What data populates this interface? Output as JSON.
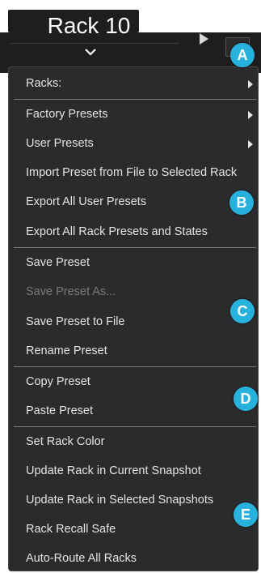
{
  "header": {
    "rack_title": "Rack 10"
  },
  "menu": {
    "items": [
      {
        "label": "Racks:",
        "submenu": true,
        "disabled": false
      },
      {
        "label": "Factory Presets",
        "submenu": true,
        "disabled": false
      },
      {
        "label": "User Presets",
        "submenu": true,
        "disabled": false
      },
      {
        "label": "Import Preset from File to Selected Rack",
        "submenu": false,
        "disabled": false
      },
      {
        "label": "Export All User Presets",
        "submenu": false,
        "disabled": false
      },
      {
        "label": "Export All Rack Presets and States",
        "submenu": false,
        "disabled": false
      },
      {
        "label": "Save Preset",
        "submenu": false,
        "disabled": false
      },
      {
        "label": "Save Preset As...",
        "submenu": false,
        "disabled": true
      },
      {
        "label": "Save Preset to File",
        "submenu": false,
        "disabled": false
      },
      {
        "label": "Rename Preset",
        "submenu": false,
        "disabled": false
      },
      {
        "label": "Copy Preset",
        "submenu": false,
        "disabled": false
      },
      {
        "label": "Paste Preset",
        "submenu": false,
        "disabled": false
      },
      {
        "label": "Set Rack Color",
        "submenu": false,
        "disabled": false
      },
      {
        "label": "Update Rack in Current Snapshot",
        "submenu": false,
        "disabled": false
      },
      {
        "label": "Update Rack in Selected Snapshots",
        "submenu": false,
        "disabled": false
      },
      {
        "label": "Rack Recall Safe",
        "submenu": false,
        "disabled": false
      },
      {
        "label": "Auto-Route All Racks",
        "submenu": false,
        "disabled": false
      }
    ]
  },
  "callouts": {
    "a": "A",
    "b": "B",
    "c": "C",
    "d": "D",
    "e": "E"
  },
  "colors": {
    "menu_bg": "#2b2b2d",
    "badge": "#27b2dd",
    "text": "#e4e4e4",
    "disabled_text": "#7a7a7c"
  }
}
